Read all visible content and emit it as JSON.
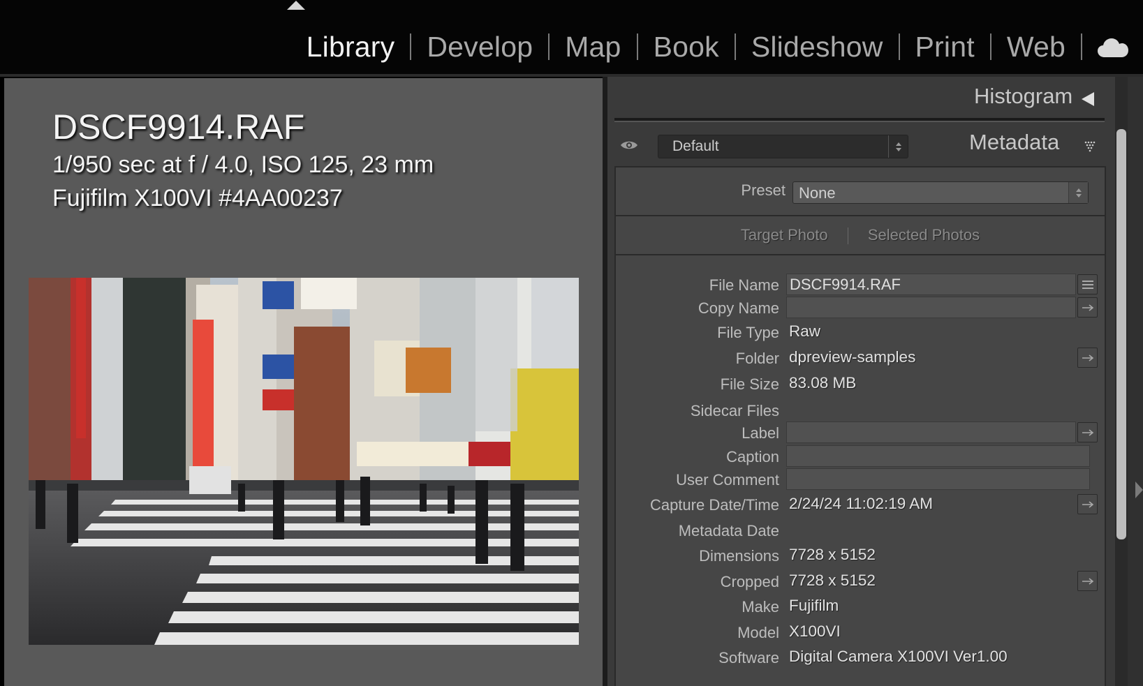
{
  "modules": [
    {
      "label": "Library",
      "active": true
    },
    {
      "label": "Develop",
      "active": false
    },
    {
      "label": "Map",
      "active": false
    },
    {
      "label": "Book",
      "active": false
    },
    {
      "label": "Slideshow",
      "active": false
    },
    {
      "label": "Print",
      "active": false
    },
    {
      "label": "Web",
      "active": false
    }
  ],
  "loupe_info": {
    "filename": "DSCF9914.RAF",
    "exposure": "1/950 sec at f / 4.0, ISO 125, 23 mm",
    "camera": "Fujifilm X100VI #4AA00237"
  },
  "panel": {
    "histogram_title": "Histogram",
    "metadata_title": "Metadata",
    "view_select": "Default",
    "preset_label": "Preset",
    "preset_value": "None",
    "target_photo": "Target Photo",
    "selected_photos": "Selected Photos"
  },
  "metadata": {
    "file_name": {
      "label": "File Name",
      "value": "DSCF9914.RAF"
    },
    "copy_name": {
      "label": "Copy Name",
      "value": ""
    },
    "file_type": {
      "label": "File Type",
      "value": "Raw"
    },
    "folder": {
      "label": "Folder",
      "value": "dpreview-samples"
    },
    "file_size": {
      "label": "File Size",
      "value": "83.08 MB"
    },
    "sidecar_files": {
      "label": "Sidecar Files",
      "value": ""
    },
    "label": {
      "label": "Label",
      "value": ""
    },
    "caption": {
      "label": "Caption",
      "value": ""
    },
    "user_comment": {
      "label": "User Comment",
      "value": ""
    },
    "capture_date": {
      "label": "Capture Date/Time",
      "value": "2/24/24 11:02:19 AM"
    },
    "metadata_date": {
      "label": "Metadata Date",
      "value": ""
    },
    "dimensions": {
      "label": "Dimensions",
      "value": "7728 x 5152"
    },
    "cropped": {
      "label": "Cropped",
      "value": "7728 x 5152"
    },
    "make": {
      "label": "Make",
      "value": "Fujifilm"
    },
    "model": {
      "label": "Model",
      "value": "X100VI"
    },
    "software": {
      "label": "Software",
      "value": "Digital Camera X100VI Ver1.00"
    }
  },
  "colors": {
    "accent_active": "#f2f2f2",
    "module_inactive": "#a9a9a9",
    "panel_bg": "#3a3a3a",
    "loupe_bg": "#595959"
  }
}
